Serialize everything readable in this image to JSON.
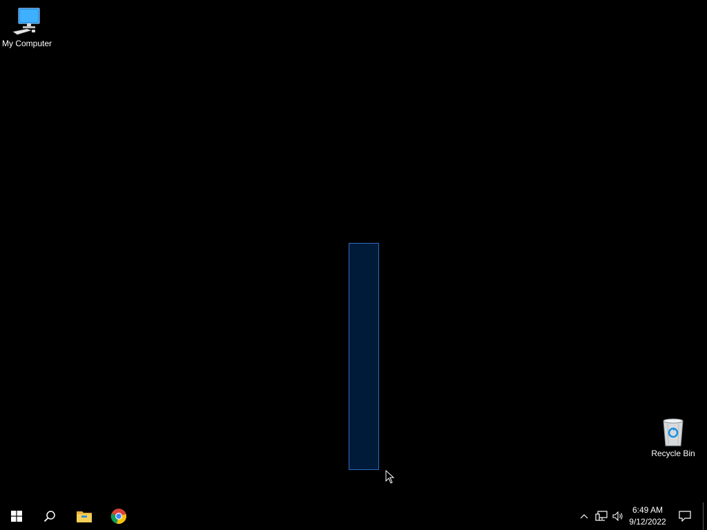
{
  "desktop": {
    "background_color": "#000000",
    "icons": [
      {
        "label": "My Computer",
        "icon": "computer-icon"
      },
      {
        "label": "Recycle Bin",
        "icon": "recycle-bin-icon"
      }
    ],
    "selection_rect_color": "#001a3a",
    "selection_border_color": "#2d6fbf"
  },
  "taskbar": {
    "background_color": "#000000",
    "pinned": [
      {
        "name": "Start",
        "icon": "windows-logo-icon"
      },
      {
        "name": "Search",
        "icon": "search-icon"
      },
      {
        "name": "File Explorer",
        "icon": "folder-icon"
      },
      {
        "name": "Google Chrome",
        "icon": "chrome-icon"
      }
    ],
    "tray": {
      "chevron_icon": "chevron-up-icon",
      "network_icon": "network-icon",
      "volume_icon": "speaker-icon",
      "time": "6:49 AM",
      "date": "9/12/2022",
      "notification_icon": "notification-icon"
    }
  }
}
